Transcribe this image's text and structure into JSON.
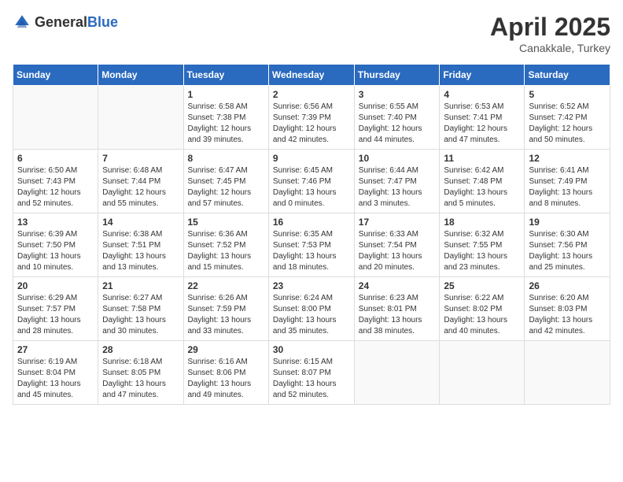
{
  "logo": {
    "general": "General",
    "blue": "Blue"
  },
  "title": {
    "month": "April 2025",
    "location": "Canakkale, Turkey"
  },
  "days_of_week": [
    "Sunday",
    "Monday",
    "Tuesday",
    "Wednesday",
    "Thursday",
    "Friday",
    "Saturday"
  ],
  "weeks": [
    [
      {
        "day": "",
        "info": ""
      },
      {
        "day": "",
        "info": ""
      },
      {
        "day": "1",
        "info": "Sunrise: 6:58 AM\nSunset: 7:38 PM\nDaylight: 12 hours and 39 minutes."
      },
      {
        "day": "2",
        "info": "Sunrise: 6:56 AM\nSunset: 7:39 PM\nDaylight: 12 hours and 42 minutes."
      },
      {
        "day": "3",
        "info": "Sunrise: 6:55 AM\nSunset: 7:40 PM\nDaylight: 12 hours and 44 minutes."
      },
      {
        "day": "4",
        "info": "Sunrise: 6:53 AM\nSunset: 7:41 PM\nDaylight: 12 hours and 47 minutes."
      },
      {
        "day": "5",
        "info": "Sunrise: 6:52 AM\nSunset: 7:42 PM\nDaylight: 12 hours and 50 minutes."
      }
    ],
    [
      {
        "day": "6",
        "info": "Sunrise: 6:50 AM\nSunset: 7:43 PM\nDaylight: 12 hours and 52 minutes."
      },
      {
        "day": "7",
        "info": "Sunrise: 6:48 AM\nSunset: 7:44 PM\nDaylight: 12 hours and 55 minutes."
      },
      {
        "day": "8",
        "info": "Sunrise: 6:47 AM\nSunset: 7:45 PM\nDaylight: 12 hours and 57 minutes."
      },
      {
        "day": "9",
        "info": "Sunrise: 6:45 AM\nSunset: 7:46 PM\nDaylight: 13 hours and 0 minutes."
      },
      {
        "day": "10",
        "info": "Sunrise: 6:44 AM\nSunset: 7:47 PM\nDaylight: 13 hours and 3 minutes."
      },
      {
        "day": "11",
        "info": "Sunrise: 6:42 AM\nSunset: 7:48 PM\nDaylight: 13 hours and 5 minutes."
      },
      {
        "day": "12",
        "info": "Sunrise: 6:41 AM\nSunset: 7:49 PM\nDaylight: 13 hours and 8 minutes."
      }
    ],
    [
      {
        "day": "13",
        "info": "Sunrise: 6:39 AM\nSunset: 7:50 PM\nDaylight: 13 hours and 10 minutes."
      },
      {
        "day": "14",
        "info": "Sunrise: 6:38 AM\nSunset: 7:51 PM\nDaylight: 13 hours and 13 minutes."
      },
      {
        "day": "15",
        "info": "Sunrise: 6:36 AM\nSunset: 7:52 PM\nDaylight: 13 hours and 15 minutes."
      },
      {
        "day": "16",
        "info": "Sunrise: 6:35 AM\nSunset: 7:53 PM\nDaylight: 13 hours and 18 minutes."
      },
      {
        "day": "17",
        "info": "Sunrise: 6:33 AM\nSunset: 7:54 PM\nDaylight: 13 hours and 20 minutes."
      },
      {
        "day": "18",
        "info": "Sunrise: 6:32 AM\nSunset: 7:55 PM\nDaylight: 13 hours and 23 minutes."
      },
      {
        "day": "19",
        "info": "Sunrise: 6:30 AM\nSunset: 7:56 PM\nDaylight: 13 hours and 25 minutes."
      }
    ],
    [
      {
        "day": "20",
        "info": "Sunrise: 6:29 AM\nSunset: 7:57 PM\nDaylight: 13 hours and 28 minutes."
      },
      {
        "day": "21",
        "info": "Sunrise: 6:27 AM\nSunset: 7:58 PM\nDaylight: 13 hours and 30 minutes."
      },
      {
        "day": "22",
        "info": "Sunrise: 6:26 AM\nSunset: 7:59 PM\nDaylight: 13 hours and 33 minutes."
      },
      {
        "day": "23",
        "info": "Sunrise: 6:24 AM\nSunset: 8:00 PM\nDaylight: 13 hours and 35 minutes."
      },
      {
        "day": "24",
        "info": "Sunrise: 6:23 AM\nSunset: 8:01 PM\nDaylight: 13 hours and 38 minutes."
      },
      {
        "day": "25",
        "info": "Sunrise: 6:22 AM\nSunset: 8:02 PM\nDaylight: 13 hours and 40 minutes."
      },
      {
        "day": "26",
        "info": "Sunrise: 6:20 AM\nSunset: 8:03 PM\nDaylight: 13 hours and 42 minutes."
      }
    ],
    [
      {
        "day": "27",
        "info": "Sunrise: 6:19 AM\nSunset: 8:04 PM\nDaylight: 13 hours and 45 minutes."
      },
      {
        "day": "28",
        "info": "Sunrise: 6:18 AM\nSunset: 8:05 PM\nDaylight: 13 hours and 47 minutes."
      },
      {
        "day": "29",
        "info": "Sunrise: 6:16 AM\nSunset: 8:06 PM\nDaylight: 13 hours and 49 minutes."
      },
      {
        "day": "30",
        "info": "Sunrise: 6:15 AM\nSunset: 8:07 PM\nDaylight: 13 hours and 52 minutes."
      },
      {
        "day": "",
        "info": ""
      },
      {
        "day": "",
        "info": ""
      },
      {
        "day": "",
        "info": ""
      }
    ]
  ]
}
